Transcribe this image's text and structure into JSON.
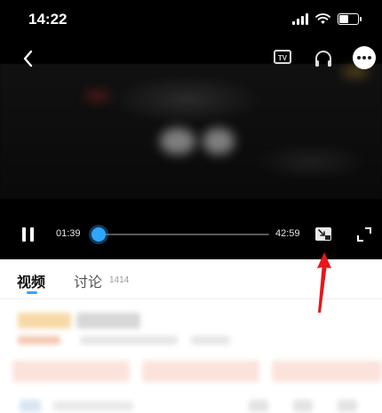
{
  "status_bar": {
    "time": "14:22"
  },
  "player": {
    "top_controls": {
      "tv_label": "TV"
    },
    "bottom_controls": {
      "current_time": "01:39",
      "total_time": "42:59",
      "progress_fraction": 0.038
    }
  },
  "tabs": {
    "video_label": "视频",
    "discuss_label": "讨论",
    "discuss_count": "1414"
  },
  "colors": {
    "accent": "#2fa6ff",
    "annotation_arrow": "#e8161b"
  },
  "icons": [
    "signal-icon",
    "wifi-icon",
    "battery-icon",
    "back-icon",
    "tv-cast-icon",
    "headphone-icon",
    "more-icon",
    "pause-icon",
    "pip-icon",
    "fullscreen-icon"
  ]
}
